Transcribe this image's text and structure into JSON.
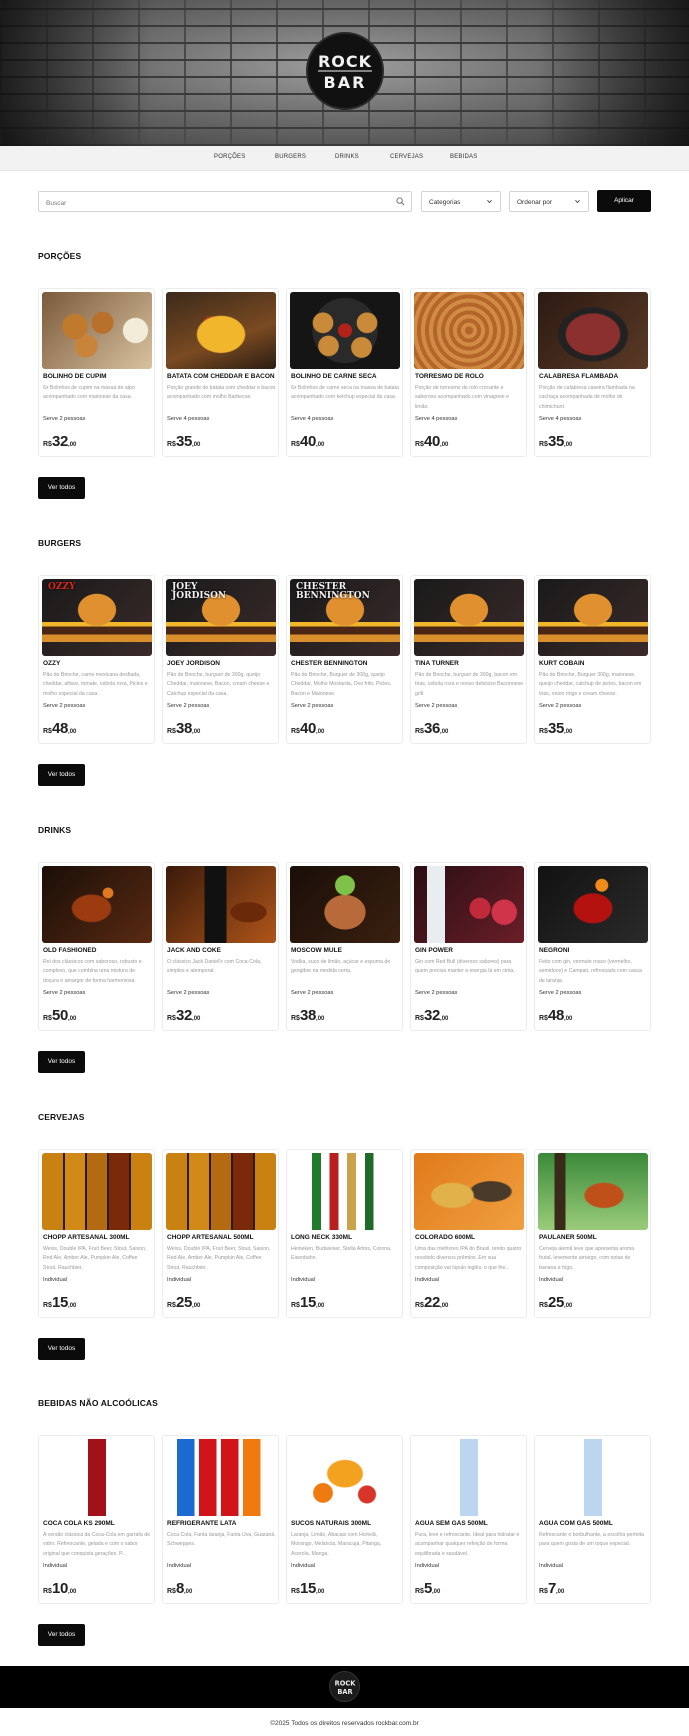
{
  "brand": {
    "logo_text": "ROCK BAR",
    "footer_logo_text": "ROCK BAR"
  },
  "nav": {
    "items": [
      "PORÇÕES",
      "BURGERS",
      "DRINKS",
      "CERVEJAS",
      "BEBIDAS"
    ]
  },
  "filters": {
    "search_placeholder": "Buscar",
    "category_label": "Categorias",
    "order_label": "Ordenar por",
    "apply_label": "Aplicar",
    "search_icon": "search-icon",
    "chevron_icon": "chevron-down-icon"
  },
  "sections": [
    {
      "title": "PORÇÕES",
      "view_all": "Ver todos",
      "items": [
        {
          "name": "BOLINHO DE CUPIM",
          "desc": "6x Bolinhos de cupim na massa de aipo acompanhado com maionese da casa.",
          "serve": "Serve 2 pessoas",
          "currency": "R$",
          "price": "32",
          "cents": ",00",
          "image": "food"
        },
        {
          "name": "BATATA COM CHEDDAR E BACON",
          "desc": "Porção grande de batata com cheddar e bacon acompanhado com molho Barbecue.",
          "serve": "Serve 4 pessoas",
          "currency": "R$",
          "price": "35",
          "cents": ",00",
          "image": "fries"
        },
        {
          "name": "BOLINHO DE CARNE SECA",
          "desc": "6x Bolinhos de carne seca na massa de batata acompanhado com ketchup especial da casa.",
          "serve": "Serve 4 pessoas",
          "currency": "R$",
          "price": "40",
          "cents": ",00",
          "image": "balls"
        },
        {
          "name": "TORRESMO DE ROLO",
          "desc": "Porção de torresmo de rolo crocante e saboroso acompanhado com vinagrete e limão.",
          "serve": "Serve 4 pessoas",
          "currency": "R$",
          "price": "40",
          "cents": ",00",
          "image": "roll"
        },
        {
          "name": "CALABRESA FLAMBADA",
          "desc": "Porção de calabresa caseira flambada na cachaça acompanhada de molho de chimichurri.",
          "serve": "Serve 4 pessoas",
          "currency": "R$",
          "price": "35",
          "cents": ",00",
          "image": "sausage"
        }
      ]
    },
    {
      "title": "BURGERS",
      "view_all": "Ver todos",
      "items": [
        {
          "name": "OZZY",
          "desc": "Pão de Brioche, carne mexicana desfiada, cheddar, alface, tomate, cebola roxa, Picles e molho especial da casa.",
          "serve": "Serve 2 pessoas",
          "currency": "R$",
          "price": "48",
          "cents": ",00",
          "image": "burger",
          "caption": "OZZY"
        },
        {
          "name": "JOEY JORDISON",
          "desc": "Pão de Brioche, burguer de 300g, queijo Cheddar, maionese, Bacon, cream cheese e Catchup especial da casa.",
          "serve": "Serve 2 pessoas",
          "currency": "R$",
          "price": "38",
          "cents": ",00",
          "image": "burger",
          "caption": "JOEY JORDISON"
        },
        {
          "name": "CHESTER BENNINGTON",
          "desc": "Pão de Brioche, Burguer de 300g, queijo Cheddar, Molho Mostarda, Ovo frito, Picles, Bacon e Maionese.",
          "serve": "Serve 2 pessoas",
          "currency": "R$",
          "price": "40",
          "cents": ",00",
          "image": "burger",
          "caption": "CHESTER BENNINGTON"
        },
        {
          "name": "TINA TURNER",
          "desc": "Pão de Brioche, burguer de 300g, bacon em tiras, cebola roxa e nosso delicioso Baconnese grill.",
          "serve": "Serve 2 pessoas",
          "currency": "R$",
          "price": "36",
          "cents": ",00",
          "image": "burger",
          "caption": ""
        },
        {
          "name": "KURT COBAIN",
          "desc": "Pão de Brioche, Burguer 300g, maionese, queijo cheddar, catchup de picles, bacon em tiras, onion rings e cream cheese.",
          "serve": "Serve 2 pessoas",
          "currency": "R$",
          "price": "35",
          "cents": ",00",
          "image": "burger",
          "caption": ""
        }
      ]
    },
    {
      "title": "DRINKS",
      "view_all": "Ver todos",
      "items": [
        {
          "name": "OLD FASHIONED",
          "desc": "Rei dos clássicos com saboroso, robusto e complexo, que combina uma mistura de doçura e amargor de forma harmoniosa.",
          "serve": "Serve 2 pessoas",
          "currency": "R$",
          "price": "50",
          "cents": ",00",
          "image": "whisky"
        },
        {
          "name": "JACK AND COKE",
          "desc": "O clássico Jack Daniel's com Coca-Cola, simples e atemporal.",
          "serve": "Serve 2 pessoas",
          "currency": "R$",
          "price": "32",
          "cents": ",00",
          "image": "jack"
        },
        {
          "name": "MOSCOW MULE",
          "desc": "Vodka, suco de limão, açúcar e espuma de gengibre na medida certa.",
          "serve": "Serve 2 pessoas",
          "currency": "R$",
          "price": "38",
          "cents": ",00",
          "image": "mule"
        },
        {
          "name": "GIN POWER",
          "desc": "Gin com Red Bull (diversos sabores) para quem precisa manter a energia lá em cima.",
          "serve": "Serve 2 pessoas",
          "currency": "R$",
          "price": "32",
          "cents": ",00",
          "image": "gin"
        },
        {
          "name": "NEGRONI",
          "desc": "Feito com gin, vermute rosso (vermelho, semidoce) e Campari, refrescado com casca de laranja.",
          "serve": "Serve 2 pessoas",
          "currency": "R$",
          "price": "48",
          "cents": ",00",
          "image": "negroni"
        }
      ]
    },
    {
      "title": "CERVEJAS",
      "view_all": "Ver todos",
      "items": [
        {
          "name": "CHOPP ARTESANAL 300ML",
          "desc": "Weiss, Double IPA, Fruit Beer, Stout, Saison, Red Ale, Amber Ale, Pumpkin Ale, Coffee Stout, Rauchbier.",
          "serve": "Individual",
          "currency": "R$",
          "price": "15",
          "cents": ",00",
          "image": "mugs"
        },
        {
          "name": "CHOPP ARTESANAL 500ML",
          "desc": "Weiss, Double IPA, Fruit Beer, Stout, Saison, Red Ale, Amber Ale, Pumpkin Ale, Coffee Stout, Rauchbier.",
          "serve": "Individual",
          "currency": "R$",
          "price": "25",
          "cents": ",00",
          "image": "mugs"
        },
        {
          "name": "LONG NECK 330ML",
          "desc": "Heineken, Budweiser, Stella Artois, Corona, Eisenbahn.",
          "serve": "Individual",
          "currency": "R$",
          "price": "15",
          "cents": ",00",
          "image": "bottles"
        },
        {
          "name": "COLORADO 600ML",
          "desc": "Uma das melhores IPA do Brasil, tendo quatro recebido diversos prêmios. Em sua composição vai lúpulo inglês, o que lhe...",
          "serve": "Individual",
          "currency": "R$",
          "price": "22",
          "cents": ",00",
          "image": "colorado"
        },
        {
          "name": "PAULANER 500ML",
          "desc": "Cerveja alemã leve que apresenta aroma frutal, levemente amargo, com notas de banana e trigo.",
          "serve": "Individual",
          "currency": "R$",
          "price": "25",
          "cents": ",00",
          "image": "paulaner"
        }
      ]
    },
    {
      "title": "BEBIDAS NÃO ALCOÓLICAS",
      "view_all": "Ver todos",
      "items": [
        {
          "name": "COCA COLA KS 290ML",
          "desc": "A versão clássica da Coca-Cola em garrafa de vidro. Refrescante, gelada e com o sabor original que conquista gerações. P...",
          "serve": "Individual",
          "currency": "R$",
          "price": "10",
          "cents": ",00",
          "image": "coke"
        },
        {
          "name": "REFRIGERANTE LATA",
          "desc": "Coca Cola, Fanta laranja, Fanta Uva, Guaraná, Schweppes.",
          "serve": "Individual",
          "currency": "R$",
          "price": "8",
          "cents": ",00",
          "image": "cans"
        },
        {
          "name": "SUCOS NATURAIS 300ML",
          "desc": "Laranja, Limão, Abacaxi com Hortelã, Morango, Melancia, Maracujá, Pitanga, Acerola, Manga.",
          "serve": "Individual",
          "currency": "R$",
          "price": "15",
          "cents": ",00",
          "image": "juice"
        },
        {
          "name": "AGUA SEM GÁS 500ML",
          "desc": "Pura, leve e refrescante. Ideal para hidratar e acompanhar qualquer refeição de forma equilibrada e saudável.",
          "serve": "Individual",
          "currency": "R$",
          "price": "5",
          "cents": ",00",
          "image": "water"
        },
        {
          "name": "AGUA COM GÁS 500ML",
          "desc": "Refrescante e borbulhante, a escolha perfeita para quem gosta de um toque especial.",
          "serve": "Individual",
          "currency": "R$",
          "price": "7",
          "cents": ",00",
          "image": "water"
        }
      ]
    }
  ],
  "footer": {
    "copyright": "©2025 Todos os direitos reservados rockbar.com.br"
  }
}
